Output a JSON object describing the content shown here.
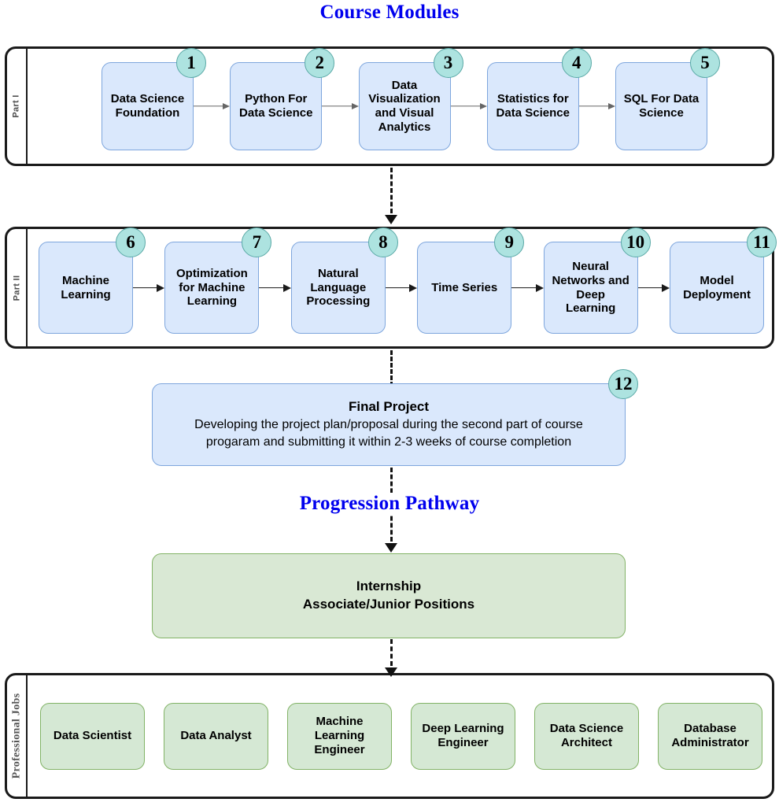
{
  "headings": {
    "course_modules": "Course Modules",
    "progression_pathway": "Progression Pathway"
  },
  "bands": [
    {
      "id": "part-1",
      "label": "Part I",
      "arrow_style": "gray",
      "nodes": [
        {
          "badge": "1",
          "label": "Data Science\nFoundation"
        },
        {
          "badge": "2",
          "label": "Python For\nData Science"
        },
        {
          "badge": "3",
          "label": "Data\nVisualization\nand Visual\nAnalytics"
        },
        {
          "badge": "4",
          "label": "Statistics for\nData Science"
        },
        {
          "badge": "5",
          "label": "SQL For Data\nScience"
        }
      ]
    },
    {
      "id": "part-2",
      "label": "Part II",
      "arrow_style": "dark",
      "nodes": [
        {
          "badge": "6",
          "label": "Machine\nLearning"
        },
        {
          "badge": "7",
          "label": "Optimization\nfor Machine\nLearning"
        },
        {
          "badge": "8",
          "label": "Natural\nLanguage\nProcessing"
        },
        {
          "badge": "9",
          "label": "Time Series"
        },
        {
          "badge": "10",
          "label": "Neural\nNetworks and\nDeep\nLearning"
        },
        {
          "badge": "11",
          "label": "Model\nDeployment"
        }
      ]
    }
  ],
  "final_project": {
    "badge": "12",
    "title": "Final Project",
    "description": "Developing the project plan/proposal during the second part of  course\nprogaram and submitting it within 2-3 weeks of course completion"
  },
  "internship": {
    "line1": "Internship",
    "line2": "Associate/Junior Positions"
  },
  "professional_jobs": {
    "label": "Professional Jobs",
    "nodes": [
      {
        "label": "Data Scientist"
      },
      {
        "label": "Data Analyst"
      },
      {
        "label": "Machine\nLearning\nEngineer"
      },
      {
        "label": "Deep Learning\nEngineer"
      },
      {
        "label": "Data Science\nArchitect"
      },
      {
        "label": "Database\nAdministrator"
      }
    ]
  },
  "colors": {
    "heading_blue": "#0000ee",
    "module_fill": "#dae8fc",
    "module_stroke": "#7ea6dd",
    "job_fill": "#d5e8d4",
    "job_stroke": "#82b366",
    "badge_fill": "#ade3e0",
    "badge_stroke": "#5aa9a6",
    "band_stroke": "#1a1a1a"
  }
}
